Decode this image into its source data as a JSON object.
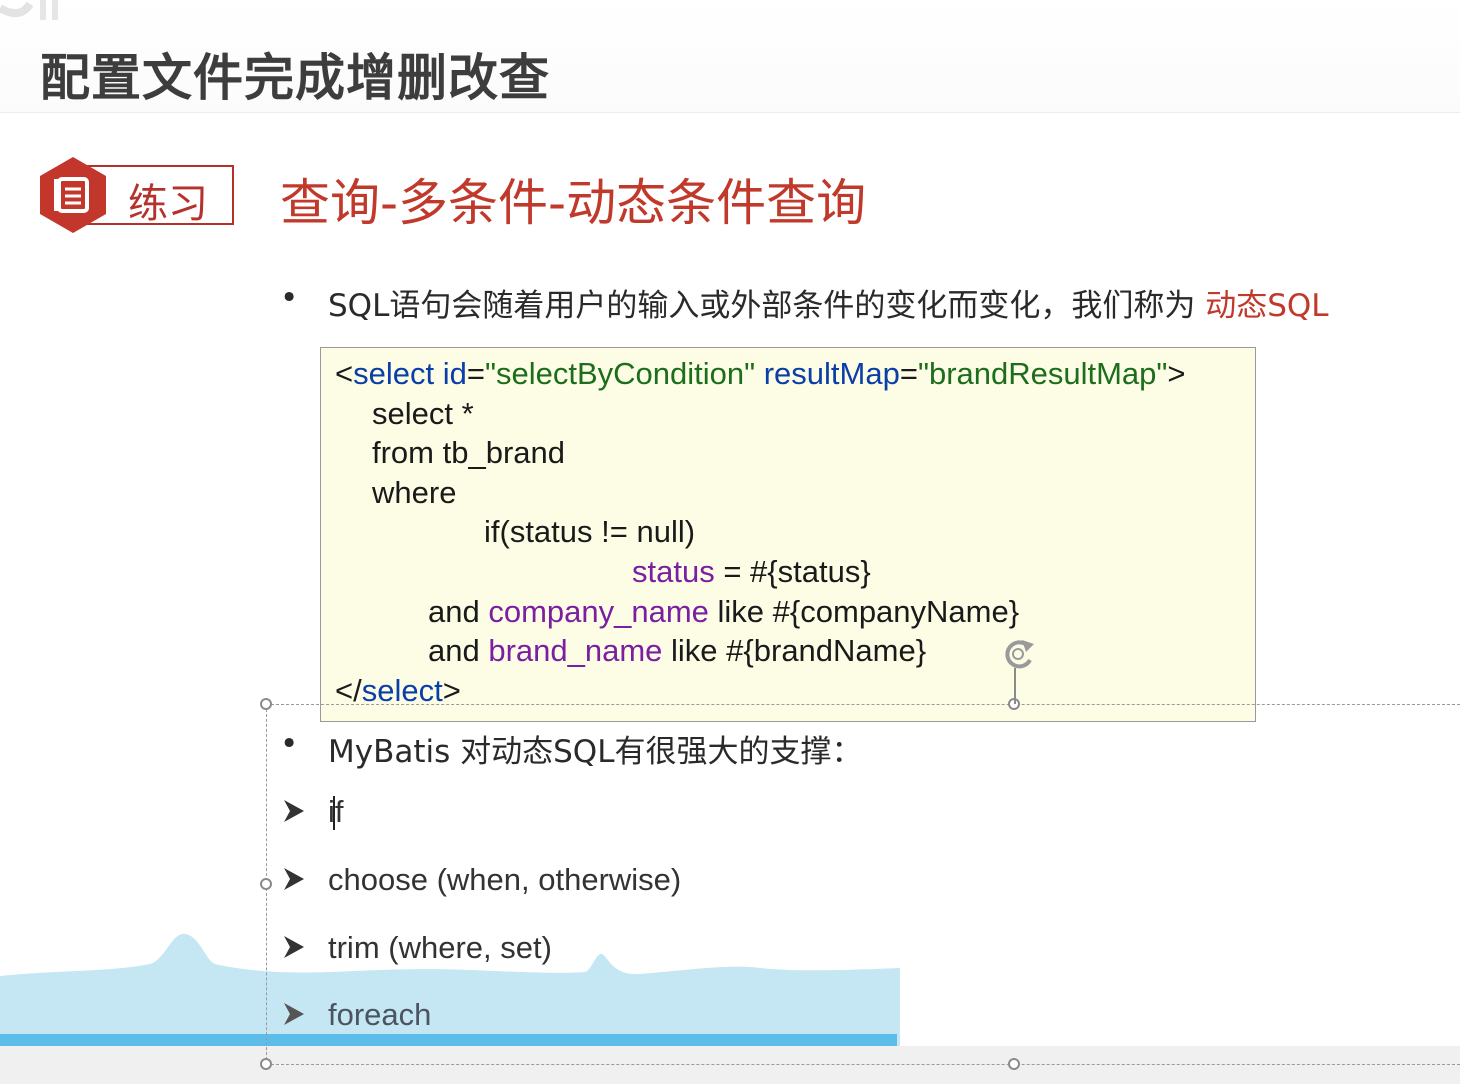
{
  "slide": {
    "title": "配置文件完成增删改查",
    "badge_label": "练习",
    "section_title": "查询-多条件-动态条件查询"
  },
  "bullets": {
    "first_text": "SQL语句会随着用户的输入或外部条件的变化而变化，我们称为 ",
    "first_highlight": "动态SQL",
    "second_text": "MyBatis 对动态SQL有很强大的支撑："
  },
  "code": {
    "line1": {
      "open": "<",
      "tag": "select",
      "attr1": " id",
      "eq1": "=",
      "val1": "\"selectByCondition\"",
      "attr2": " resultMap",
      "eq2": "=",
      "val2": "\"brandResultMap\"",
      "close": ">"
    },
    "line2": "select *",
    "line3": "from tb_brand",
    "line4": "where",
    "line5": "if(status != null)",
    "line6": {
      "col": "status",
      "rest": " = #{status}"
    },
    "line7": {
      "pre": "and ",
      "col": "company_name",
      "rest": " like #{companyName}"
    },
    "line8": {
      "pre": "and ",
      "col": "brand_name",
      "rest": " like #{brandName}"
    },
    "line9": {
      "open": "</",
      "tag": "select",
      "close": ">"
    }
  },
  "features": [
    "if",
    "choose (when, otherwise)",
    "trim (where, set)",
    "foreach"
  ],
  "colors": {
    "accent_red": "#c0392b",
    "code_bg": "#fdfde6",
    "keyword_blue": "#0a3ea8",
    "string_green": "#1c6e1c",
    "column_purple": "#7a1fa2",
    "wave_blue": "#c5e6f3"
  },
  "icons": [
    "document-icon",
    "arrow-bullet-icon",
    "rotate-handle-icon"
  ]
}
